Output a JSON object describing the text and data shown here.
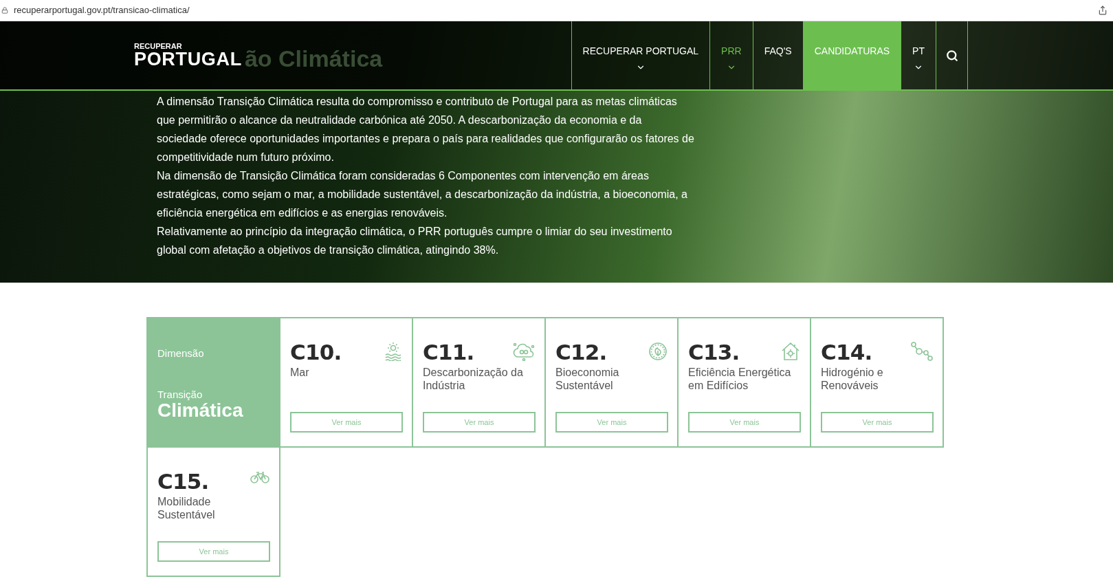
{
  "browser": {
    "url": "recuperarportugal.gov.pt/transicao-climatica/"
  },
  "header": {
    "logo": {
      "top": "RECUPERAR",
      "main": "PORTUGAL"
    },
    "hero_title_visible": "ão Climática",
    "nav": [
      {
        "label": "RECUPERAR PORTUGAL",
        "kind": "link",
        "selected": false,
        "dropdown": true
      },
      {
        "label": "PRR",
        "kind": "link",
        "selected": true,
        "dropdown": true
      },
      {
        "label": "FAQ'S",
        "kind": "link",
        "selected": false,
        "dropdown": false
      },
      {
        "label": "CANDIDATURAS",
        "kind": "cta",
        "selected": false,
        "dropdown": false
      },
      {
        "label": "PT",
        "kind": "link",
        "selected": false,
        "dropdown": true
      }
    ]
  },
  "hero": {
    "paragraphs": [
      "A dimensão Transição Climática resulta do compromisso e contributo de Portugal para as metas climáticas que permitirão o alcance da neutralidade carbónica até 2050. A descarbonização da economia e da sociedade oferece oportunidades importantes e prepara o país para realidades que configurarão os fatores de competitividade num futuro próximo.",
      "Na dimensão de Transição Climática foram consideradas 6 Componentes com intervenção em áreas estratégicas, como sejam o mar, a mobilidade sustentável, a descarbonização da indústria, a bioeconomia, a eficiência energética em edifícios e as energias renováveis.",
      "Relativamente ao princípio da integração climática, o PRR português cumpre o limiar do seu investimento global com afetação a objetivos de transição climática, atingindo 38%."
    ]
  },
  "dimension": {
    "label": "Dimensão",
    "title_small": "Transição",
    "title_large": "Climática"
  },
  "components": [
    {
      "code": "C10.",
      "name": "Mar",
      "kind": "sea",
      "button": "Ver mais"
    },
    {
      "code": "C11.",
      "name": "Descarbonização da Indústria",
      "kind": "co2",
      "button": "Ver mais"
    },
    {
      "code": "C12.",
      "name": "Bioeconomia Sustentável",
      "kind": "leaf",
      "button": "Ver mais"
    },
    {
      "code": "C13.",
      "name": "Eficiência Energética em Edifícios",
      "kind": "house",
      "button": "Ver mais"
    },
    {
      "code": "C14.",
      "name": "Hidrogénio e Renováveis",
      "kind": "molecule",
      "button": "Ver mais"
    },
    {
      "code": "C15.",
      "name": "Mobilidade Sustentável",
      "kind": "bike",
      "button": "Ver mais"
    }
  ]
}
